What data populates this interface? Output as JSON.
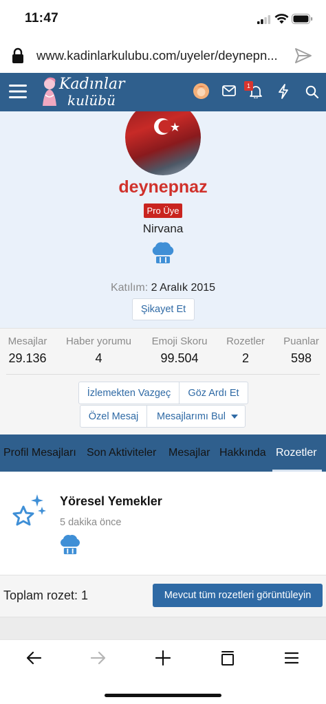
{
  "status_bar": {
    "time": "11:47"
  },
  "browser": {
    "url": "www.kadinlarkulubu.com/uyeler/deynepn..."
  },
  "site": {
    "logo_line1": "Kadınlar",
    "logo_line2": "kulübü",
    "notification_count": "1"
  },
  "profile": {
    "username": "deynepnaz",
    "badge": "Pro Üye",
    "title": "Nirvana",
    "joined_label": "Katılım:",
    "joined_value": "2 Aralık 2015",
    "report_label": "Şikayet Et"
  },
  "stats": [
    {
      "label": "Mesajlar",
      "value": "29.136"
    },
    {
      "label": "Haber yorumu",
      "value": "4"
    },
    {
      "label": "Emoji Skoru",
      "value": "99.504"
    },
    {
      "label": "Rozetler",
      "value": "2"
    },
    {
      "label": "Puanlar",
      "value": "598"
    }
  ],
  "actions": {
    "unfollow": "İzlemekten Vazgeç",
    "ignore": "Göz Ardı Et",
    "private_message": "Özel Mesaj",
    "find_messages": "Mesajlarımı Bul"
  },
  "tabs": [
    "Profil Mesajları",
    "Son Aktiviteler",
    "Mesajlar",
    "Hakkında",
    "Rozetler"
  ],
  "active_tab": "Rozetler",
  "badge_item": {
    "title": "Yöresel Yemekler",
    "time": "5 dakika önce"
  },
  "summary": {
    "total": "Toplam rozet: 1",
    "view_all": "Mevcut tüm rozetleri görüntüleyin"
  },
  "colors": {
    "header": "#2f5f8d",
    "accent": "#2f6aa5",
    "username": "#d0312b",
    "profile_bg": "#eaf1fa"
  }
}
